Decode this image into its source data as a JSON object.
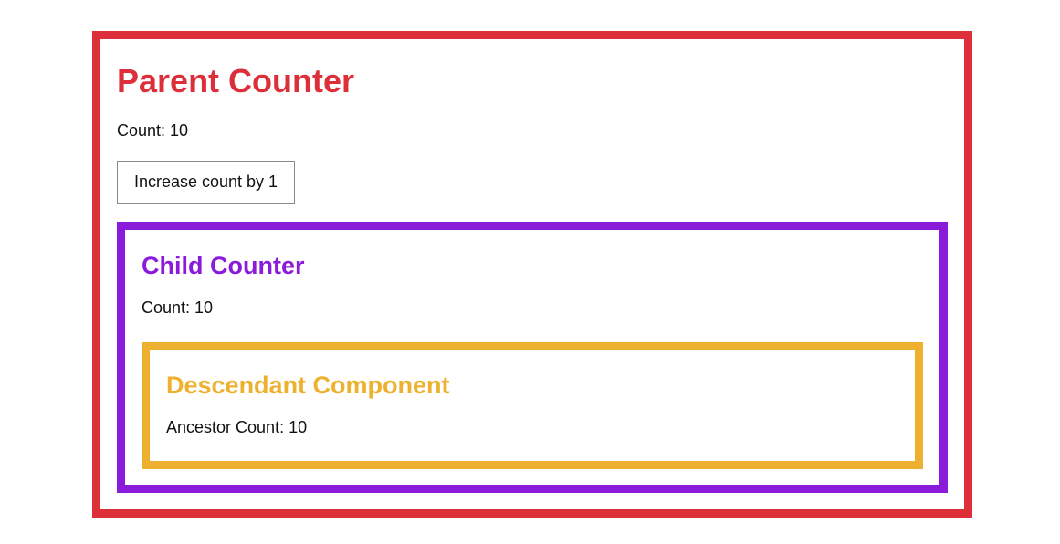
{
  "parent": {
    "title": "Parent Counter",
    "count_text": "Count: 10",
    "button_label": "Increase count by 1",
    "border_color": "#dc2f3a"
  },
  "child": {
    "title": "Child Counter",
    "count_text": "Count: 10",
    "border_color": "#8a1bdb"
  },
  "descendant": {
    "title": "Descendant Component",
    "count_text": "Ancestor Count: 10",
    "border_color": "#eeb12f"
  }
}
